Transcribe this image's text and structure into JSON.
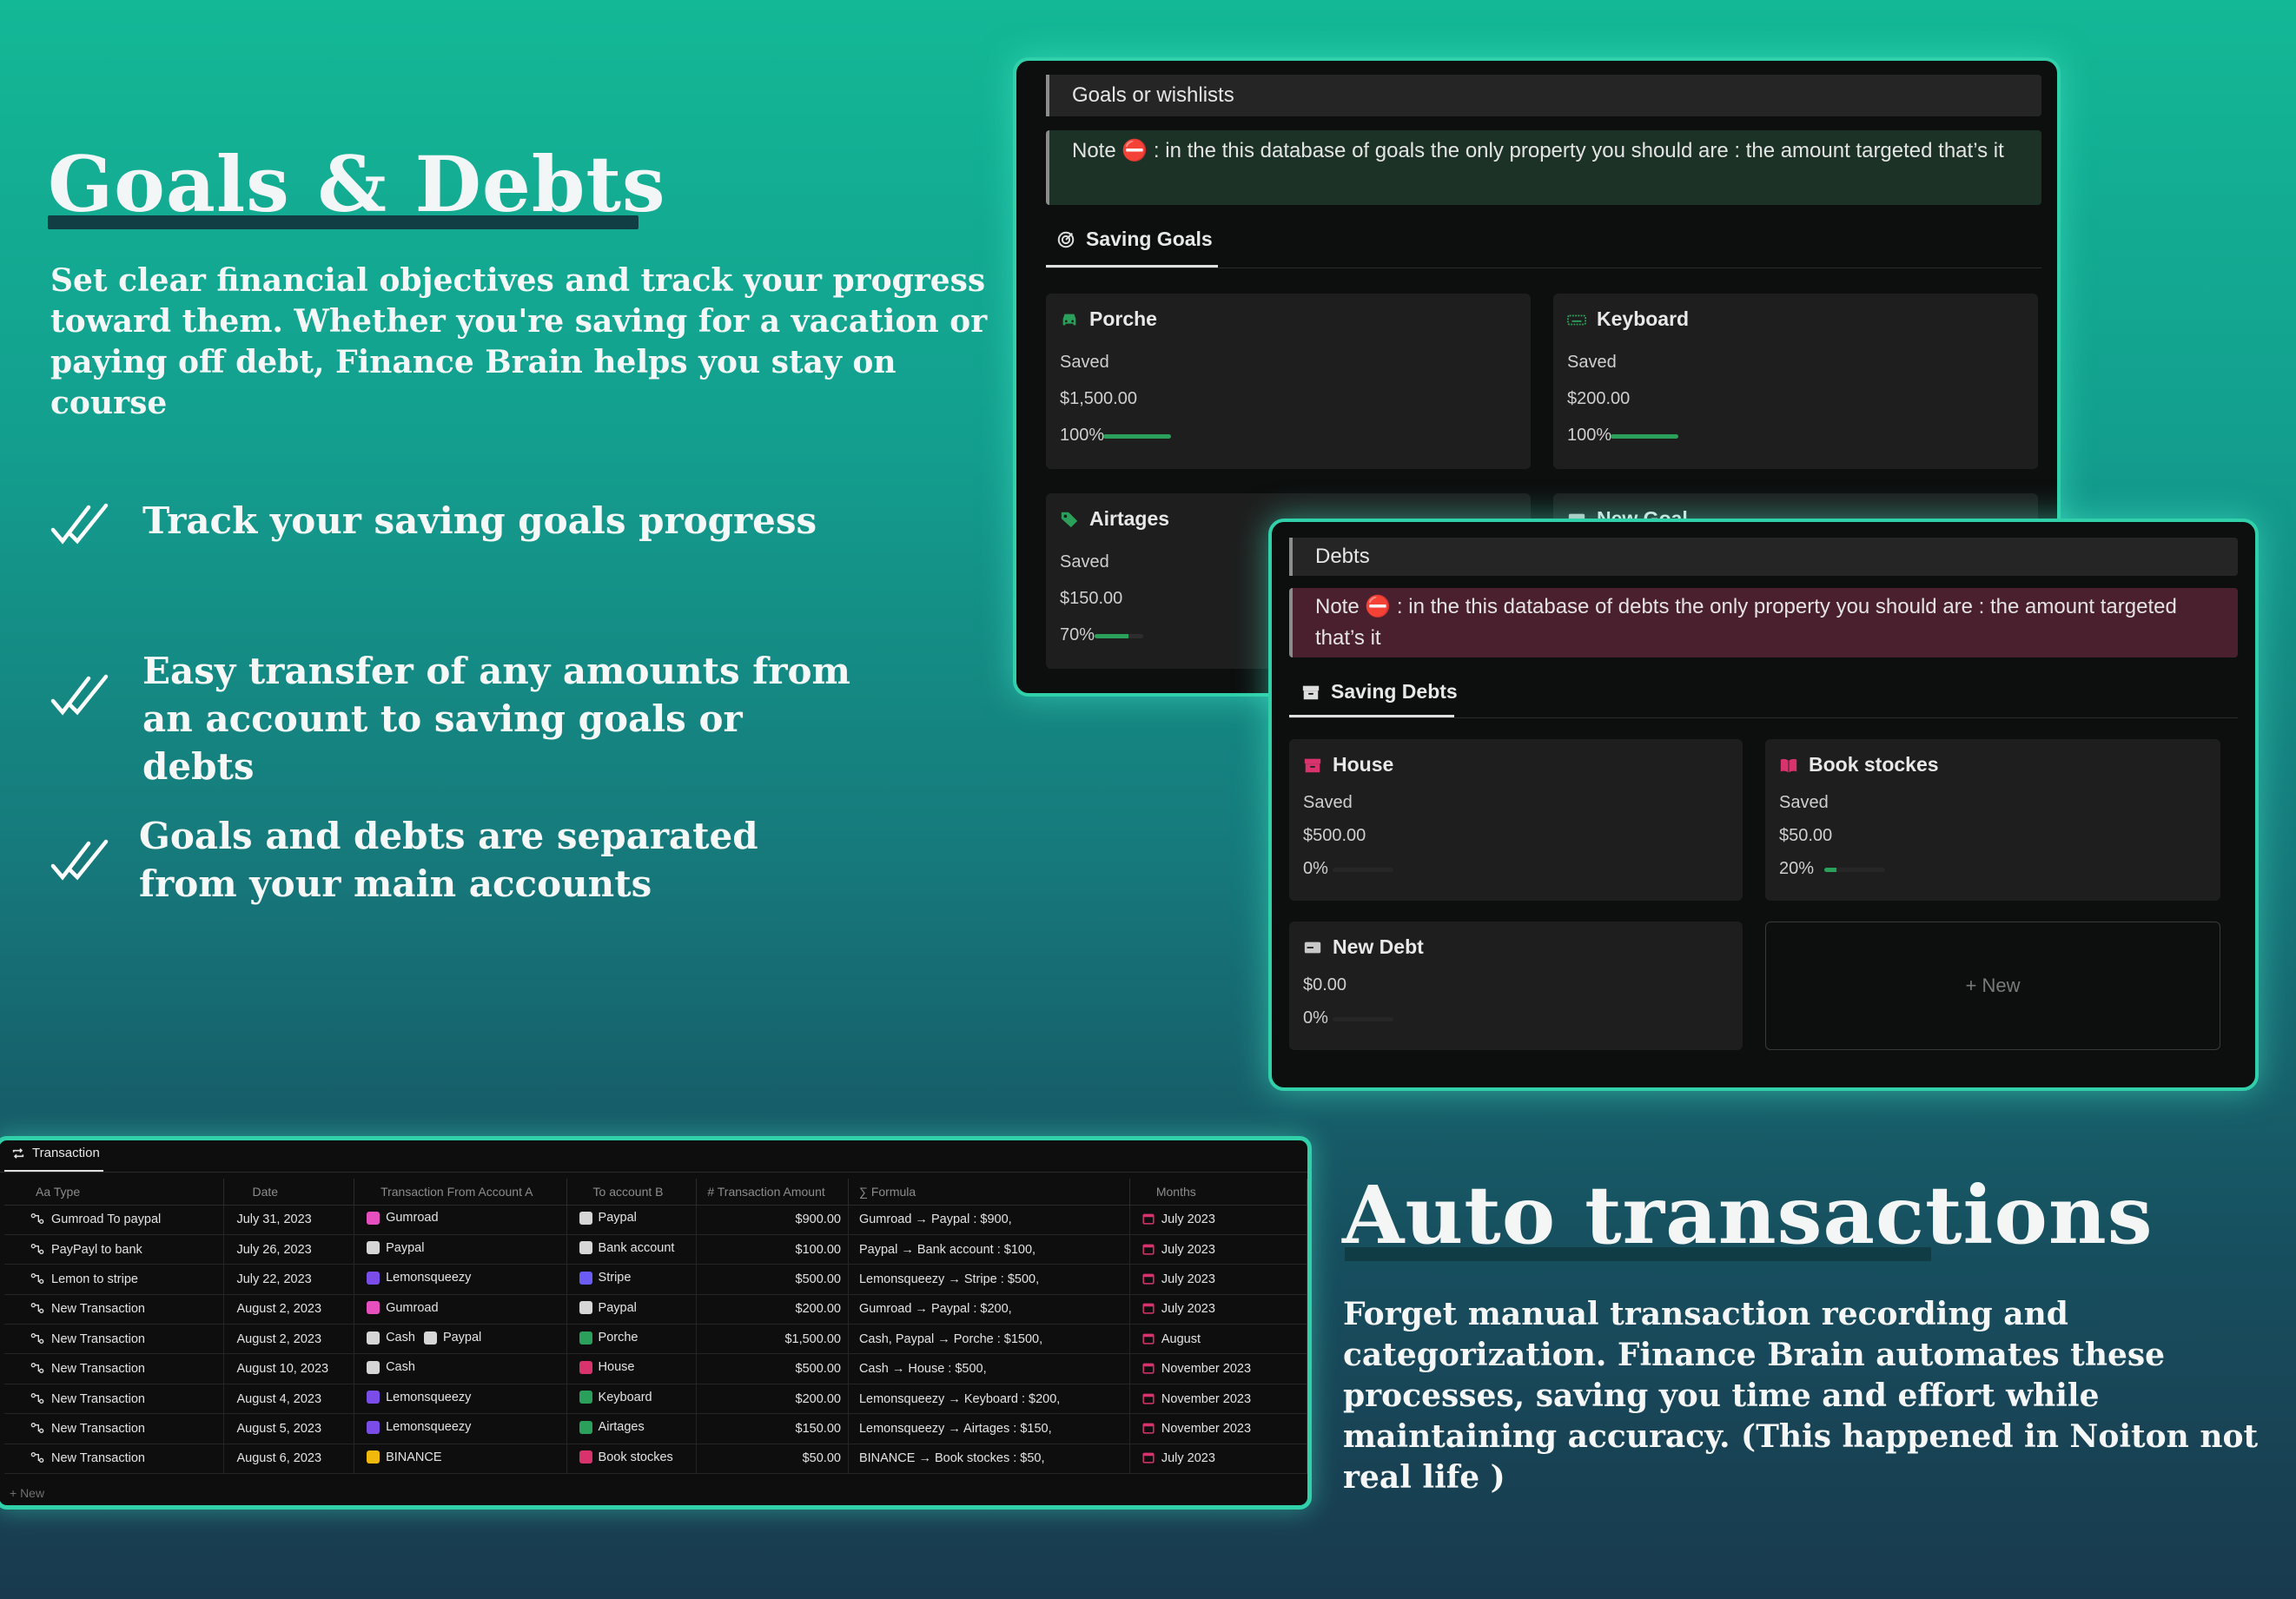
{
  "hero": {
    "title": "Goals & Debts",
    "description": "Set clear financial objectives and track your progress toward them. Whether you're saving for a vacation or paying off debt, Finance Brain helps you stay on course",
    "features": [
      "Track your saving goals progress",
      "Easy transfer of any amounts from an account to saving goals or debts",
      "Goals and debts are separated from your main accounts"
    ]
  },
  "goals_panel": {
    "title": "Goals or wishlists",
    "note": "Note ⛔ : in the this database of goals the only property you should are : the amount targeted that’s it",
    "tab_label": "Saving Goals",
    "cards": [
      {
        "name": "Porche",
        "icon": "car-icon",
        "saved_label": "Saved",
        "amount": "$1,500.00",
        "percent_label": "100%",
        "progress": 1.0
      },
      {
        "name": "Keyboard",
        "icon": "keyboard-icon",
        "saved_label": "Saved",
        "amount": "$200.00",
        "percent_label": "100%",
        "progress": 1.0
      },
      {
        "name": "Airtages",
        "icon": "tag-icon",
        "saved_label": "Saved",
        "amount": "$150.00",
        "percent_label": "70%",
        "progress": 0.7
      },
      {
        "name": "New Goal",
        "icon": "card-icon"
      }
    ]
  },
  "debts_panel": {
    "title": "Debts",
    "note": "Note ⛔ : in the this database of debts the only property you should are : the amount targeted that’s it",
    "tab_label": "Saving Debts",
    "cards": [
      {
        "name": "House",
        "icon": "archive-icon",
        "saved_label": "Saved",
        "amount": "$500.00",
        "percent_label": "0%",
        "progress": 0.0
      },
      {
        "name": "Book stockes",
        "icon": "book-icon",
        "saved_label": "Saved",
        "amount": "$50.00",
        "percent_label": "20%",
        "progress": 0.2
      },
      {
        "name": "New Debt",
        "icon": "card-icon",
        "amount": "$0.00",
        "percent_label": "0%",
        "progress": 0.0
      }
    ],
    "new_label": "+ New"
  },
  "transactions": {
    "tab_label": "Transaction",
    "columns": [
      "Aa Type",
      "Date",
      "Transaction From Account A",
      "To account B",
      "# Transaction Amount",
      "∑ Formula",
      "Months"
    ],
    "rows": [
      {
        "type": "Gumroad To paypal",
        "date": "July 31, 2023",
        "from": [
          "Gumroad"
        ],
        "to": "Paypal",
        "amount": "$900.00",
        "formula": "Gumroad → Paypal : $900,",
        "month": "July 2023"
      },
      {
        "type": "PayPayl to bank",
        "date": "July 26, 2023",
        "from": [
          "Paypal"
        ],
        "to": "Bank account",
        "amount": "$100.00",
        "formula": "Paypal → Bank account : $100,",
        "month": "July 2023"
      },
      {
        "type": "Lemon to stripe",
        "date": "July 22, 2023",
        "from": [
          "Lemonsqueezy"
        ],
        "to": "Stripe",
        "amount": "$500.00",
        "formula": "Lemonsqueezy → Stripe : $500,",
        "month": "July 2023"
      },
      {
        "type": "New Transaction",
        "date": "August 2, 2023",
        "from": [
          "Gumroad"
        ],
        "to": "Paypal",
        "amount": "$200.00",
        "formula": "Gumroad → Paypal : $200,",
        "month": "July 2023"
      },
      {
        "type": "New Transaction",
        "date": "August 2, 2023",
        "from": [
          "Cash",
          "Paypal"
        ],
        "to": "Porche",
        "amount": "$1,500.00",
        "formula": "Cash, Paypal → Porche : $1500,",
        "month": "August"
      },
      {
        "type": "New Transaction",
        "date": "August 10, 2023",
        "from": [
          "Cash"
        ],
        "to": "House",
        "amount": "$500.00",
        "formula": "Cash → House : $500,",
        "month": "November 2023"
      },
      {
        "type": "New Transaction",
        "date": "August 4, 2023",
        "from": [
          "Lemonsqueezy"
        ],
        "to": "Keyboard",
        "amount": "$200.00",
        "formula": "Lemonsqueezy → Keyboard : $200,",
        "month": "November 2023"
      },
      {
        "type": "New Transaction",
        "date": "August 5, 2023",
        "from": [
          "Lemonsqueezy"
        ],
        "to": "Airtages",
        "amount": "$150.00",
        "formula": "Lemonsqueezy → Airtages : $150,",
        "month": "November 2023"
      },
      {
        "type": "New Transaction",
        "date": "August 6, 2023",
        "from": [
          "BINANCE"
        ],
        "to": "Book stockes",
        "amount": "$50.00",
        "formula": "BINANCE → Book stockes : $50,",
        "month": "July 2023"
      }
    ],
    "new_label": "+ New"
  },
  "auto": {
    "title": "Auto transactions",
    "description": "Forget manual transaction recording and categorization. Finance Brain automates these processes, saving you time and effort while maintaining accuracy. (This happened in Noiton not real life )"
  },
  "colors": {
    "accent": "#2fd0aa",
    "progress": "#2aa05a",
    "goal_note_bg": "#1c3226",
    "debt_note_bg": "#4a1f2e"
  }
}
